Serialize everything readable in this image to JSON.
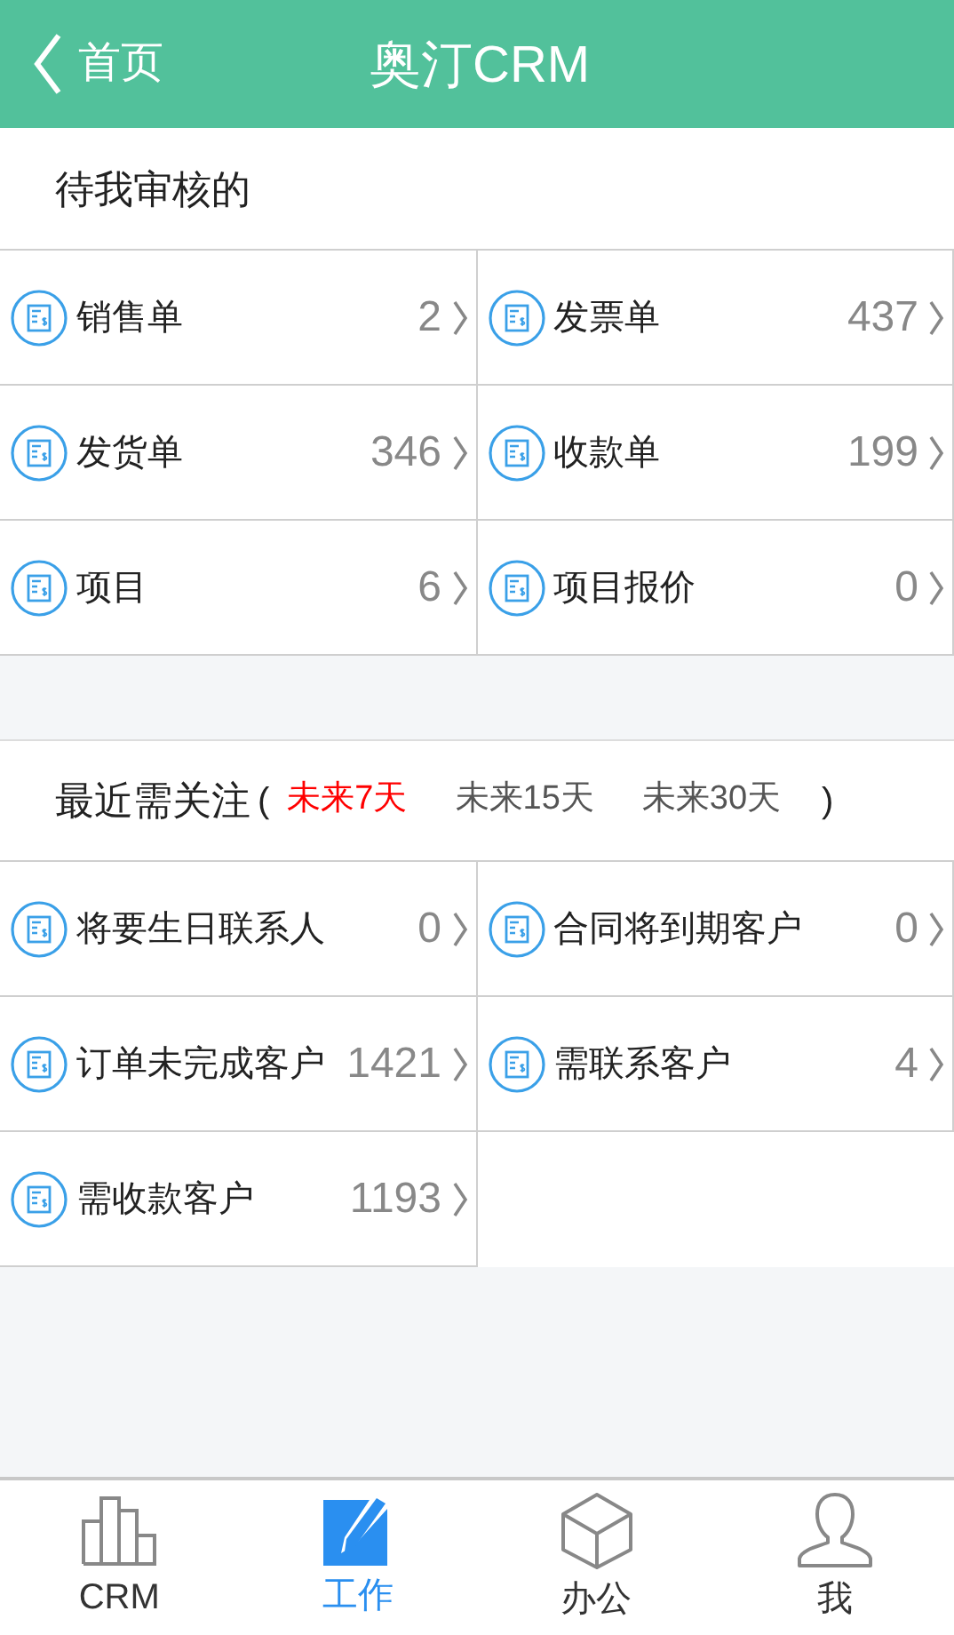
{
  "header": {
    "back_label": "首页",
    "title": "奥汀CRM"
  },
  "pending_section": {
    "title": "待我审核的",
    "items": [
      {
        "label": "销售单",
        "count": "2"
      },
      {
        "label": "发票单",
        "count": "437"
      },
      {
        "label": "发货单",
        "count": "346"
      },
      {
        "label": "收款单",
        "count": "199"
      },
      {
        "label": "项目",
        "count": "6"
      },
      {
        "label": "项目报价",
        "count": "0"
      }
    ]
  },
  "attention_section": {
    "title": "最近需关注",
    "open_paren": "(",
    "close_paren": ")",
    "filters": [
      {
        "label": "未来7天",
        "selected": true
      },
      {
        "label": "未来15天",
        "selected": false
      },
      {
        "label": "未来30天",
        "selected": false
      }
    ],
    "items": [
      {
        "label": "将要生日联系人",
        "count": "0"
      },
      {
        "label": "合同将到期客户",
        "count": "0"
      },
      {
        "label": "订单未完成客户",
        "count": "1421"
      },
      {
        "label": "需联系客户",
        "count": "4"
      },
      {
        "label": "需收款客户",
        "count": "1193"
      }
    ]
  },
  "tab_bar": [
    {
      "label": "CRM",
      "kind": "chart",
      "selected": false
    },
    {
      "label": "工作",
      "kind": "edit",
      "selected": true
    },
    {
      "label": "办公",
      "kind": "box",
      "selected": false
    },
    {
      "label": "我",
      "kind": "user",
      "selected": false
    }
  ]
}
